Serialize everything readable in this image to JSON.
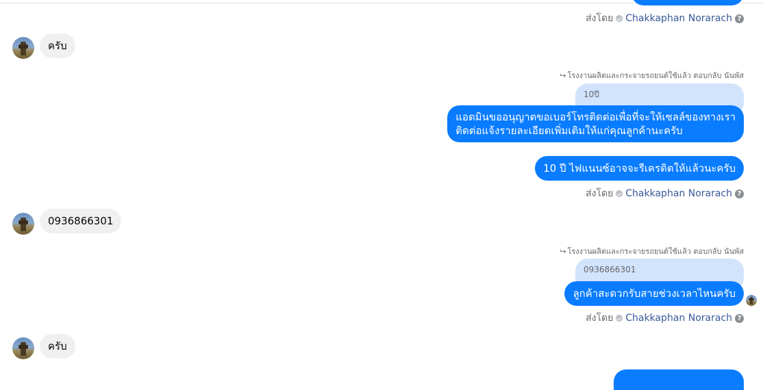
{
  "sent_by": {
    "prefix": "ส่งโดย",
    "name": "Chakkaphan Norarach"
  },
  "reply_meta": "โรงงานผลิตและกระจายรถยนต์ใช้แล้ว ตอบกลับ นันพัส",
  "messages": {
    "in1": "ครับ",
    "in2": "0936866301",
    "in3": "ครับ",
    "quote1": "10ปี",
    "out1_line1": "แอดมินขออนุญาตขอเบอร์โทรติดต่อเพื่อที่จะให้เซลล์ของทางเรา",
    "out1_line2": "ติดต่อแจ้งรายละเอียดเพิ่มเติมให้แก่คุณลูกค้านะครับ",
    "out2": "10 ปี ไฟแนนซ์อาจจะรีเครดิตให้แล้วนะครับ",
    "quote2": "0936866301",
    "out3": "ลูกค้าสะดวกรับสายช่วงเวลาไหนครับ"
  },
  "icons": {
    "verified": "check-circle-icon",
    "help": "question-icon",
    "reply": "reply-arrow-icon"
  },
  "colors": {
    "outgoing": "#0a7cff",
    "incoming": "#f0f0f0",
    "quote": "#d2e3fc",
    "name": "#385898"
  }
}
